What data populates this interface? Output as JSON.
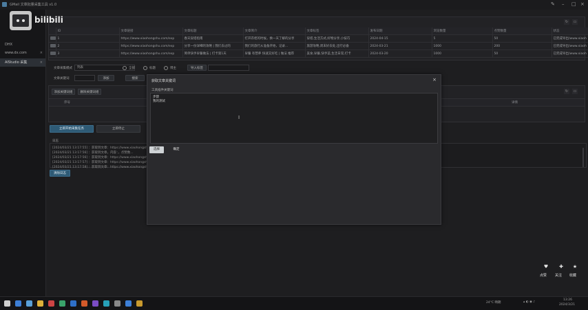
{
  "window": {
    "title": "GMail 文章批量采集工具 v1.0"
  },
  "sidebar": {
    "items": [
      {
        "label": "DHX"
      },
      {
        "label": "www.dx.com"
      },
      {
        "label": "AIStudio 采集"
      }
    ]
  },
  "top_table": {
    "headers": [
      "",
      "ID",
      "文章链接",
      "文章标题",
      "文章简介",
      "文章标签",
      "发布日期",
      "浏览数量",
      "点赞数量",
      "状态"
    ],
    "rows": [
      [
        "",
        "1",
        "https://www.xiaohongshu.com/exp",
        "春天穿搭指南",
        "打开衣柜的时候，换一天了解的分享",
        "穿搭,生活方式,好物分享,小技巧",
        "2024-04-15",
        "5",
        "50",
        "已完成导出/www.xiaoh"
      ],
      [
        "",
        "2",
        "https://www.xiaohongshu.com/exp",
        "分享一份详细的攻略 | 我们去过的",
        "我们的旅行从准备开始，记录...",
        "旅游攻略,周末好去处,出行必备",
        "2024-03-21",
        "1000",
        "200",
        "已完成导出/www.xiaoh"
      ],
      [
        "",
        "3",
        "https://www.xiaohongshu.com/exp",
        "简单快手早餐做法 | 打卡第1天",
        "早餐 有营养 快速又好吃 | 做法 推荐",
        "美食,早餐,快手菜,生活日常,打卡",
        "2024-03-20",
        "1000",
        "50",
        "已完成导出/www.xiaoh"
      ]
    ]
  },
  "controls": {
    "mode_label": "文章采集模式",
    "mode_value": "列表",
    "radio1": "全部",
    "radio2": "标题",
    "radio3": "博主",
    "import_button": "导入标签",
    "keyword_label": "文章关键词",
    "add_button": "添加",
    "search_button": "搜索"
  },
  "sub_panel": {
    "btn1": "添加关键词组",
    "btn2": "删除关键词组",
    "header_num": "序号",
    "header_detail": "详情"
  },
  "action_buttons": {
    "start": "立即开始采集任务",
    "stop": "立即停止"
  },
  "log": {
    "title": "日志",
    "lines": [
      "[2024/03/21 13:17:55] ：获取到文章：https://www.xiaohongshu.com...",
      "[2024/03/21 13:17:56] ：获取到文章，内容：，点赞数...",
      "[2024/03/21 13:17:56] ：获取到文章：https://www.xiaohongshu.com...",
      "[2024/03/21 13:17:57] ：获取到文章：https://www.xiaohongshu.com...",
      "[2024/03/21 13:17:58] ：获取到文章：https://www.xiaohongshu.com..."
    ],
    "clear_button": "清除日志"
  },
  "dialog": {
    "title": "获取文章关键词",
    "close": "×",
    "subtitle": "工具插件关键词",
    "text": "步骤\n我的测试",
    "select_button": "选择",
    "next_button": "确定"
  },
  "watermark": {
    "text": "bilibili"
  },
  "overlay_buttons": [
    "点赞",
    "关注",
    "收藏"
  ],
  "taskbar": {
    "weather": "24°C 晴朗",
    "time": "13:26",
    "date": "2024/3/21"
  },
  "colors": {
    "primary_button": "#2e5a75",
    "background": "#1e1e20"
  }
}
